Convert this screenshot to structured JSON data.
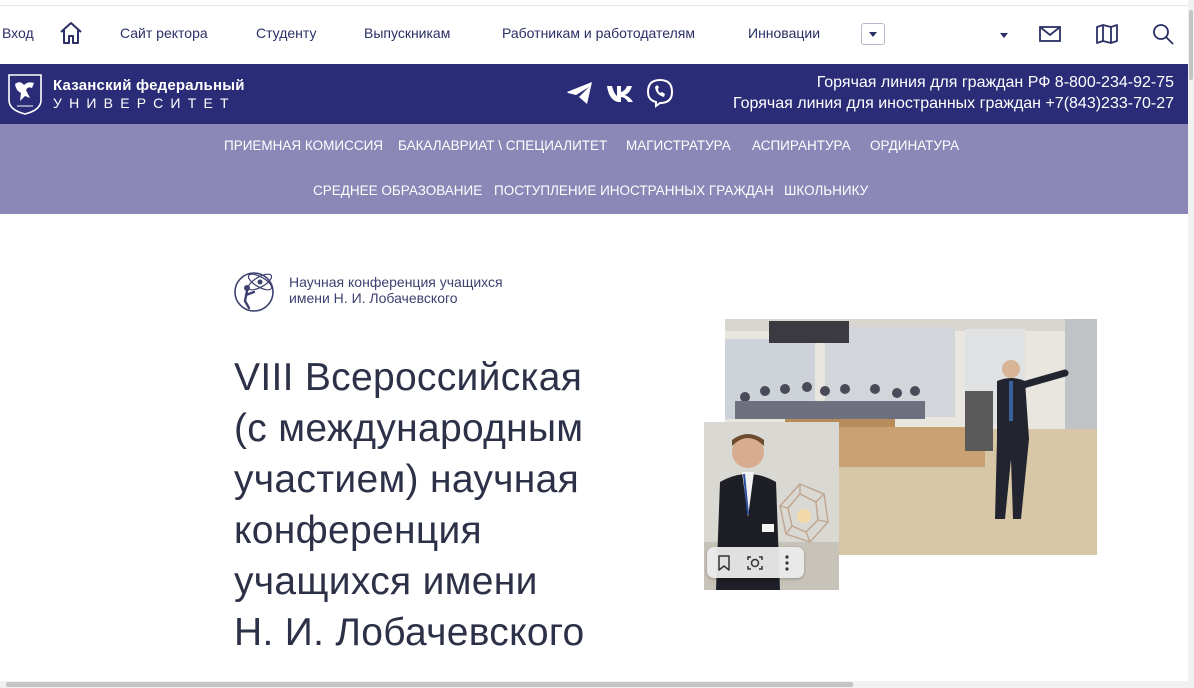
{
  "topnav": {
    "login": "Вход",
    "items": [
      "Сайт ректора",
      "Студенту",
      "Выпускникам",
      "Работникам и работодателям",
      "Инновации"
    ]
  },
  "header": {
    "logo_line1": "Казанский федеральный",
    "logo_line2": "УНИВЕРСИТЕТ",
    "hotline_rf": "Горячая линия для граждан РФ 8-800-234-92-75",
    "hotline_foreign": "Горячая линия для иностранных граждан +7(843)233-70-27",
    "brand_color": "#2a2c77"
  },
  "menu": {
    "row1": [
      "ПРИЕМНАЯ КОМИССИЯ",
      "БАКАЛАВРИАТ \\ СПЕЦИАЛИТЕТ",
      "МАГИСТРАТУРА",
      "АСПИРАНТУРА",
      "ОРДИНАТУРА"
    ],
    "row2": [
      "СРЕДНЕЕ ОБРАЗОВАНИЕ",
      "ПОСТУПЛЕНИЕ ИНОСТРАННЫХ ГРАЖДАН",
      "ШКОЛЬНИКУ"
    ],
    "color": "#8b88b8"
  },
  "content": {
    "conference_line1": "Научная конференция учащихся",
    "conference_line2": "имени Н. И. Лобачевского",
    "headline": [
      "VIII Всероссийская",
      "(с международным",
      "участием) научная",
      "конференция",
      "учащихся имени",
      "Н. И. Лобачевского"
    ]
  },
  "icons": {
    "home": "home-icon",
    "mail": "mail-icon",
    "map": "map-icon",
    "search": "search-icon",
    "telegram": "telegram-icon",
    "vk": "vk-icon",
    "viber": "viber-icon",
    "bookmark": "bookmark-icon",
    "lens": "lens-search-icon",
    "more": "more-vertical-icon"
  }
}
